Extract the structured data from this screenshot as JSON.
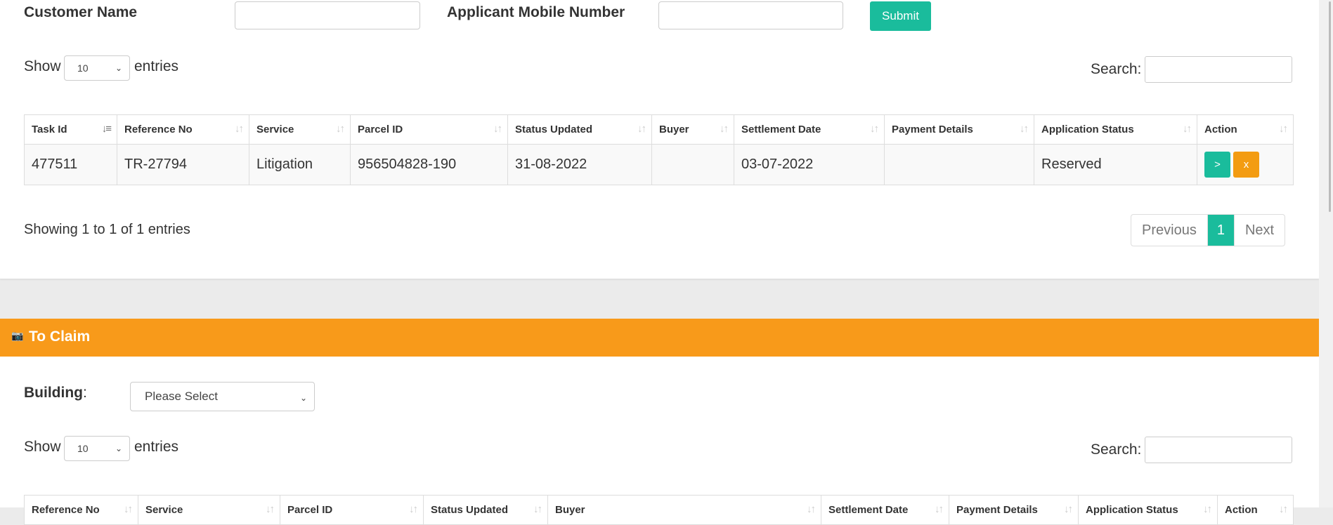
{
  "filter": {
    "customer_label": "Customer Name",
    "mobile_label": "Applicant Mobile Number",
    "submit_label": "Submit"
  },
  "table1": {
    "show_label": "Show",
    "entries_label": "entries",
    "length_value": "10",
    "search_label": "Search:",
    "columns": [
      "Task Id",
      "Reference No",
      "Service",
      "Parcel ID",
      "Status Updated",
      "Buyer",
      "Settlement Date",
      "Payment Details",
      "Application Status",
      "Action"
    ],
    "rows": [
      {
        "task_id": "477511",
        "reference_no": "TR-27794",
        "service": "Litigation",
        "parcel_id": "956504828-190",
        "status_updated": "31-08-2022",
        "buyer": "",
        "settlement_date": "03-07-2022",
        "payment_details": "",
        "application_status": "Reserved",
        "action_go": ">",
        "action_cancel": "x"
      }
    ],
    "info": "Showing 1 to 1 of 1 entries",
    "pagination": {
      "previous": "Previous",
      "current": "1",
      "next": "Next"
    }
  },
  "claim": {
    "icon": "camera-icon",
    "title": "To Claim",
    "building_label": "Building",
    "building_colon": ":",
    "building_value": "Please Select",
    "show_label": "Show",
    "entries_label": "entries",
    "length_value": "10",
    "search_label": "Search:",
    "columns": [
      "Reference No",
      "Service",
      "Parcel ID",
      "Status Updated",
      "Buyer",
      "Settlement Date",
      "Payment Details",
      "Application Status",
      "Action"
    ]
  },
  "colors": {
    "accent_green": "#1abc9c",
    "accent_orange": "#f89a1a"
  }
}
